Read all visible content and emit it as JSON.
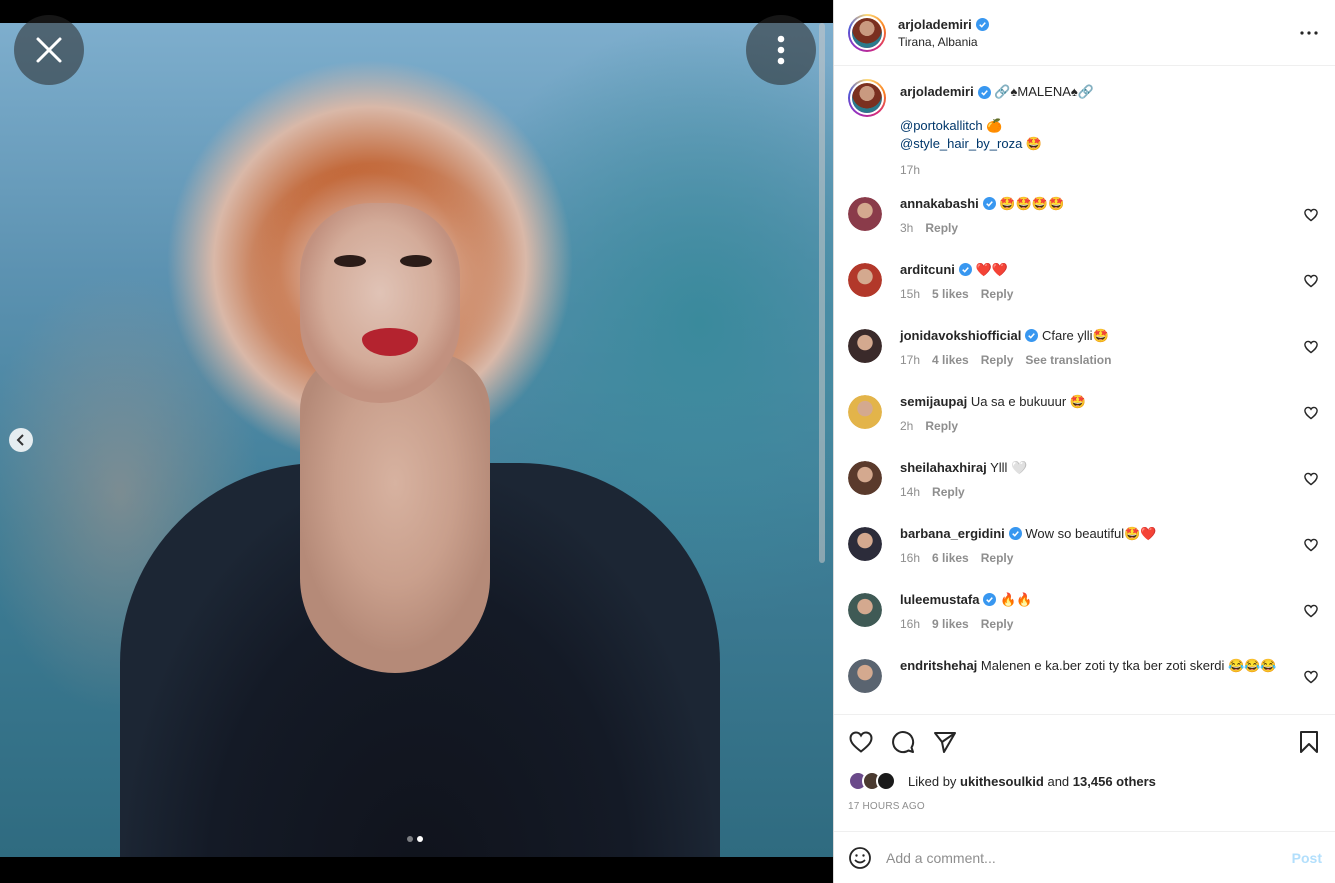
{
  "media": {
    "close_icon": "close-icon",
    "more_icon": "more-vertical-icon",
    "prev_icon": "chevron-left-icon",
    "carousel_total": 2,
    "carousel_active": 2
  },
  "header": {
    "username": "arjolademiri",
    "location": "Tirana, Albania"
  },
  "caption": {
    "username": "arjolademiri",
    "text": "🔗♠MALENA♠🔗",
    "tags": [
      "@portokallitch 🍊",
      "@style_hair_by_roza 🤩"
    ],
    "time": "17h"
  },
  "comments": [
    {
      "username": "annakabashi",
      "verified": true,
      "text": "🤩🤩🤩🤩",
      "time": "3h",
      "likes": "",
      "reply": "Reply",
      "translate": "",
      "avatar_color": "#8a3b4a"
    },
    {
      "username": "arditcuni",
      "verified": true,
      "text": "❤️❤️",
      "time": "15h",
      "likes": "5 likes",
      "reply": "Reply",
      "translate": "",
      "avatar_color": "#b2382a"
    },
    {
      "username": "jonidavokshiofficial",
      "verified": true,
      "text": "Cfare ylli🤩",
      "time": "17h",
      "likes": "4 likes",
      "reply": "Reply",
      "translate": "See translation",
      "avatar_color": "#3a2a2a"
    },
    {
      "username": "semijaupaj",
      "verified": false,
      "text": "Ua sa e bukuuur 🤩",
      "time": "2h",
      "likes": "",
      "reply": "Reply",
      "translate": "",
      "avatar_color": "#e3b44a"
    },
    {
      "username": "sheilahaxhiraj",
      "verified": false,
      "text": "Ylll 🤍",
      "time": "14h",
      "likes": "",
      "reply": "Reply",
      "translate": "",
      "avatar_color": "#5a3a2c"
    },
    {
      "username": "barbana_ergidini",
      "verified": true,
      "text": "Wow so beautiful🤩❤️",
      "time": "16h",
      "likes": "6 likes",
      "reply": "Reply",
      "translate": "",
      "avatar_color": "#2c2c3a"
    },
    {
      "username": "luleemustafa",
      "verified": true,
      "text": "🔥🔥",
      "time": "16h",
      "likes": "9 likes",
      "reply": "Reply",
      "translate": "",
      "avatar_color": "#3f5a55"
    },
    {
      "username": "endritshehaj",
      "verified": false,
      "text": "Malenen e ka.ber zoti ty tka ber zoti skerdi 😂😂😂",
      "time": "",
      "likes": "",
      "reply": "",
      "translate": "",
      "avatar_color": "#5a6470"
    }
  ],
  "actions": {
    "like_icon": "heart-icon",
    "comment_icon": "comment-icon",
    "share_icon": "share-icon",
    "save_icon": "bookmark-icon"
  },
  "likes": {
    "prefix": "Liked by",
    "user": "ukithesoulkid",
    "and": "and",
    "others": "13,456 others"
  },
  "post_time": "17 HOURS AGO",
  "add_comment": {
    "placeholder": "Add a comment...",
    "post_label": "Post"
  }
}
